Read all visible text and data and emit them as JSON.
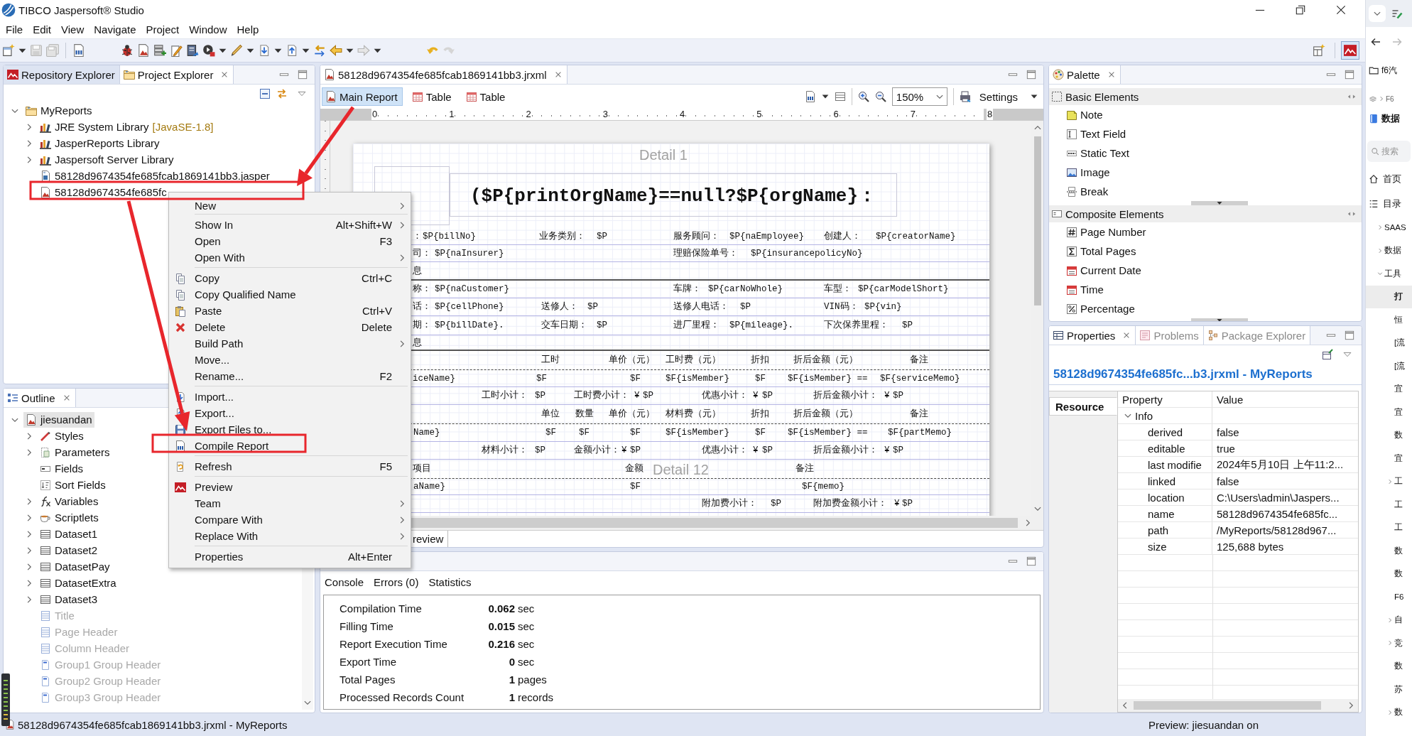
{
  "window": {
    "title": "TIBCO Jaspersoft® Studio"
  },
  "menu": [
    "File",
    "Edit",
    "View",
    "Navigate",
    "Project",
    "Window",
    "Help"
  ],
  "project_explorer": {
    "tabs": [
      {
        "label": "Repository Explorer",
        "selected": false
      },
      {
        "label": "Project Explorer",
        "selected": true
      }
    ],
    "tree": [
      {
        "label": "MyReports",
        "kind": "project",
        "expandable": true,
        "expanded": true,
        "children": [
          {
            "label": "JRE System Library",
            "decoration": "[JavaSE-1.8]",
            "kind": "library",
            "expandable": true,
            "expanded": false
          },
          {
            "label": "JasperReports Library",
            "kind": "library",
            "expandable": true,
            "expanded": false
          },
          {
            "label": "Jaspersoft Server Library",
            "kind": "library",
            "expandable": true,
            "expanded": false
          },
          {
            "label": "58128d9674354fe685fcab1869141bb3.jasper",
            "kind": "compiled",
            "expandable": false,
            "expanded": false
          },
          {
            "label": "58128d9674354fe685fc",
            "kind": "report",
            "expandable": false,
            "expanded": false
          }
        ]
      }
    ]
  },
  "outline": {
    "tab": "Outline",
    "tree": [
      {
        "label": "jiesuandan",
        "kind": "report",
        "expandable": true,
        "expanded": true,
        "selected": true,
        "disabled": false,
        "children": [
          {
            "label": "Styles",
            "kind": "styles",
            "expandable": true,
            "expanded": false,
            "selected": false,
            "disabled": false
          },
          {
            "label": "Parameters",
            "kind": "parameters",
            "expandable": true,
            "expanded": false,
            "selected": false,
            "disabled": false
          },
          {
            "label": "Fields",
            "kind": "fields",
            "expandable": false,
            "expanded": false,
            "selected": false,
            "disabled": false
          },
          {
            "label": "Sort Fields",
            "kind": "sort_fields",
            "expandable": false,
            "expanded": false,
            "selected": false,
            "disabled": false
          },
          {
            "label": "Variables",
            "kind": "variables",
            "expandable": true,
            "expanded": false,
            "selected": false,
            "disabled": false
          },
          {
            "label": "Scriptlets",
            "kind": "scriptlets",
            "expandable": true,
            "expanded": false,
            "selected": false,
            "disabled": false
          },
          {
            "label": "Dataset1",
            "kind": "dataset",
            "expandable": true,
            "expanded": false,
            "selected": false,
            "disabled": false
          },
          {
            "label": "Dataset2",
            "kind": "dataset",
            "expandable": true,
            "expanded": false,
            "selected": false,
            "disabled": false
          },
          {
            "label": "DatasetPay",
            "kind": "dataset",
            "expandable": true,
            "expanded": false,
            "selected": false,
            "disabled": false
          },
          {
            "label": "DatasetExtra",
            "kind": "dataset",
            "expandable": true,
            "expanded": false,
            "selected": false,
            "disabled": false
          },
          {
            "label": "Dataset3",
            "kind": "dataset",
            "expandable": true,
            "expanded": false,
            "selected": false,
            "disabled": false
          },
          {
            "label": "Title",
            "kind": "band",
            "expandable": false,
            "expanded": false,
            "selected": false,
            "disabled": true
          },
          {
            "label": "Page Header",
            "kind": "band",
            "expandable": false,
            "expanded": false,
            "selected": false,
            "disabled": true
          },
          {
            "label": "Column Header",
            "kind": "band",
            "expandable": false,
            "expanded": false,
            "selected": false,
            "disabled": true
          },
          {
            "label": "Group1 Group Header",
            "kind": "group_band",
            "expandable": false,
            "expanded": false,
            "selected": false,
            "disabled": true
          },
          {
            "label": "Group2 Group Header",
            "kind": "group_band",
            "expandable": false,
            "expanded": false,
            "selected": false,
            "disabled": true
          },
          {
            "label": "Group3 Group Header",
            "kind": "group_band",
            "expandable": false,
            "expanded": false,
            "selected": false,
            "disabled": true
          }
        ]
      }
    ]
  },
  "editor": {
    "tab": "58128d9674354fe685fcab1869141bb3.jrxml",
    "views": [
      {
        "label": "Main Report",
        "selected": true
      },
      {
        "label": "Table",
        "selected": false
      },
      {
        "label": "Table",
        "selected": false
      }
    ],
    "zoom": "150%",
    "settings": "Settings",
    "ruler": [
      "0",
      "1",
      "2",
      "3",
      "4",
      "5",
      "6",
      "7",
      "8"
    ],
    "band_labels": [
      "Detail 1",
      "Detail 12"
    ],
    "title": "($P{printOrgName}==null?$P{orgName}：",
    "canvas_lines": [
      {
        "kind": "fields",
        "texts": [
          "：",
          "$P{billNo}",
          "业务类别：",
          "$P",
          "服务顾问：",
          "$P{naEmployee}",
          "创建人：",
          "$P{creatorName}"
        ]
      },
      {
        "kind": "fields",
        "texts": [
          "司：",
          "$P{naInsurer}",
          "理赔保险单号：",
          "$P{insurancepolicyNo}"
        ]
      },
      {
        "kind": "section",
        "texts": [
          "息"
        ]
      },
      {
        "kind": "fields",
        "texts": [
          "称：",
          "$P{naCustomer}",
          "车牌：",
          "$P{carNoWhole}",
          "车型：",
          "$P{carModelShort}"
        ]
      },
      {
        "kind": "fields",
        "texts": [
          "话：",
          "$P{cellPhone}",
          "送修人：",
          "$P",
          "送修人电话：",
          "$P",
          "VIN码：",
          "$P{vin}"
        ]
      },
      {
        "kind": "fields",
        "texts": [
          "期：",
          "$P{billDate}.",
          "交车日期：",
          "$P",
          "进厂里程：",
          "$P{mileage}.",
          "下次保养里程：",
          "$P"
        ]
      },
      {
        "kind": "section",
        "texts": [
          "息"
        ]
      },
      {
        "kind": "header",
        "texts": [
          "工时",
          "单价（元）",
          "工时费（元）",
          "折扣",
          "折后金额（元）",
          "备注"
        ]
      },
      {
        "kind": "fields",
        "texts": [
          "iceName}",
          "$F",
          "$F",
          "$F{isMember}",
          "$F",
          "$F{isMember} ==",
          "$F{serviceMemo}"
        ]
      },
      {
        "kind": "fields",
        "texts": [
          "工时小计：",
          "$P",
          "工时费小计：",
          "¥",
          "$P",
          "优惠小计：",
          "¥",
          "$P",
          "折后金额小计：",
          "¥",
          "$P"
        ]
      },
      {
        "kind": "header",
        "texts": [
          "单位",
          "数量",
          "单价（元）",
          "材料费（元）",
          "折扣",
          "折后金额（元）",
          "备注"
        ]
      },
      {
        "kind": "fields",
        "texts": [
          "Name}",
          "$F",
          "$F",
          "$F",
          "$F{isMember}",
          "$F",
          "$F{isMember} ==",
          "$F{partMemo}"
        ]
      },
      {
        "kind": "fields",
        "texts": [
          "材料小计：",
          "$P",
          "金额小计：",
          "¥",
          "$P",
          "优惠小计：",
          "¥",
          "$P",
          "折后金额小计：",
          "¥",
          "$P"
        ]
      },
      {
        "kind": "header",
        "texts": [
          "项目",
          "金额",
          "备注"
        ]
      },
      {
        "kind": "fields",
        "texts": [
          "aName}",
          "$F",
          "$F{memo}"
        ]
      },
      {
        "kind": "fields",
        "texts": [
          "附加费小计：",
          "$P",
          "附加费金额小计：",
          "¥",
          "$P"
        ]
      }
    ],
    "bottom_tabs": [
      {
        "label": "review",
        "selected": false
      }
    ]
  },
  "context_menu": {
    "groups": [
      [
        {
          "label": "New",
          "submenu": true
        }
      ],
      [
        {
          "label": "Show In",
          "shortcut": "Alt+Shift+W",
          "submenu": true
        },
        {
          "label": "Open",
          "shortcut": "F3",
          "submenu": false
        },
        {
          "label": "Open With",
          "submenu": true
        }
      ],
      [
        {
          "label": "Copy",
          "shortcut": "Ctrl+C",
          "submenu": false
        },
        {
          "label": "Copy Qualified Name",
          "submenu": false
        },
        {
          "label": "Paste",
          "shortcut": "Ctrl+V",
          "submenu": false
        },
        {
          "label": "Delete",
          "shortcut": "Delete",
          "submenu": false
        },
        {
          "label": "Build Path",
          "submenu": true
        },
        {
          "label": "Move...",
          "submenu": false
        },
        {
          "label": "Rename...",
          "shortcut": "F2",
          "submenu": false
        }
      ],
      [
        {
          "label": "Import...",
          "submenu": false
        },
        {
          "label": "Export...",
          "submenu": false
        },
        {
          "label": "Export Files to...",
          "submenu": false
        },
        {
          "label": "Compile Report",
          "submenu": false
        }
      ],
      [
        {
          "label": "Refresh",
          "shortcut": "F5",
          "submenu": false
        }
      ],
      [
        {
          "label": "Preview",
          "submenu": false
        },
        {
          "label": "Team",
          "submenu": true
        },
        {
          "label": "Compare With",
          "submenu": true
        },
        {
          "label": "Replace With",
          "submenu": true
        }
      ],
      [
        {
          "label": "Properties",
          "shortcut": "Alt+Enter",
          "submenu": false
        }
      ]
    ]
  },
  "console": {
    "tabs": [
      "Console",
      "Errors (0)",
      "Statistics"
    ],
    "stats": [
      {
        "label": "Compilation Time",
        "value": "0.062",
        "unit": "sec"
      },
      {
        "label": "Filling Time",
        "value": "0.015",
        "unit": "sec"
      },
      {
        "label": "Report Execution Time",
        "value": "0.216",
        "unit": "sec"
      },
      {
        "label": "Export Time",
        "value": "0",
        "unit": "sec"
      },
      {
        "label": "Total Pages",
        "value": "1",
        "unit": "pages"
      },
      {
        "label": "Processed Records Count",
        "value": "1",
        "unit": "records"
      }
    ]
  },
  "palette": {
    "tab": "Palette",
    "sections": [
      {
        "title": "Basic Elements",
        "items": [
          {
            "label": "Note",
            "kind": "note"
          },
          {
            "label": "Text Field",
            "kind": "text_field"
          },
          {
            "label": "Static Text",
            "kind": "static_text"
          },
          {
            "label": "Image",
            "kind": "image"
          },
          {
            "label": "Break",
            "kind": "break"
          }
        ]
      },
      {
        "title": "Composite Elements",
        "items": [
          {
            "label": "Page Number",
            "kind": "page_number"
          },
          {
            "label": "Total Pages",
            "kind": "total_pages"
          },
          {
            "label": "Current Date",
            "kind": "current_date"
          },
          {
            "label": "Time",
            "kind": "time"
          },
          {
            "label": "Percentage",
            "kind": "percentage"
          }
        ]
      }
    ]
  },
  "properties": {
    "tabs": [
      {
        "label": "Properties",
        "selected": true
      },
      {
        "label": "Problems",
        "selected": false
      },
      {
        "label": "Package Explorer",
        "selected": false
      }
    ],
    "heading": "58128d9674354fe685fc...b3.jrxml - MyReports",
    "side_tabs": [
      {
        "label": "Resource",
        "selected": true
      }
    ],
    "columns": [
      "Property",
      "Value"
    ],
    "groups": [
      {
        "label": "Info",
        "expanded": true,
        "rows": [
          {
            "property": "derived",
            "value": "false"
          },
          {
            "property": "editable",
            "value": "true"
          },
          {
            "property": "last modifie",
            "value": "2024年5月10日 上午11:2..."
          },
          {
            "property": "linked",
            "value": "false"
          },
          {
            "property": "location",
            "value": "C:\\Users\\admin\\Jaspers..."
          },
          {
            "property": "name",
            "value": "58128d9674354fe685fc..."
          },
          {
            "property": "path",
            "value": "/MyReports/58128d967..."
          },
          {
            "property": "size",
            "value": "125,688 bytes"
          }
        ]
      }
    ]
  },
  "status_bar": {
    "left": "58128d9674354fe685fcab1869141bb3.jrxml - MyReports",
    "right": "Preview: jiesuandan on"
  },
  "browser_sidebar": {
    "folder": "f6汽",
    "breadcrumb": "F6",
    "doc_title": "数据",
    "search": {
      "placeholder": "搜索"
    },
    "nav": [
      "首页",
      "目录"
    ],
    "tree": [
      {
        "label": "SAAS",
        "expandable": true,
        "expanded": false,
        "selected": false
      },
      {
        "label": "数据",
        "expandable": true,
        "expanded": false,
        "selected": false
      },
      {
        "label": "工具",
        "expandable": true,
        "expanded": true,
        "selected": false,
        "children": [
          {
            "label": "打",
            "expandable": false,
            "expanded": false,
            "selected": true
          },
          {
            "label": "恒",
            "expandable": false,
            "expanded": false,
            "selected": false
          },
          {
            "label": "[流",
            "expandable": false,
            "expanded": false,
            "selected": false
          },
          {
            "label": "[流",
            "expandable": false,
            "expanded": false,
            "selected": false
          },
          {
            "label": "宜",
            "expandable": false,
            "expanded": false,
            "selected": false
          },
          {
            "label": "宜",
            "expandable": false,
            "expanded": false,
            "selected": false
          },
          {
            "label": "数",
            "expandable": false,
            "expanded": false,
            "selected": false
          },
          {
            "label": "宜",
            "expandable": false,
            "expanded": false,
            "selected": false
          },
          {
            "label": "工",
            "expandable": true,
            "expanded": false,
            "selected": false
          },
          {
            "label": "工",
            "expandable": false,
            "expanded": false,
            "selected": false
          },
          {
            "label": "工",
            "expandable": false,
            "expanded": false,
            "selected": false
          },
          {
            "label": "数",
            "expandable": false,
            "expanded": false,
            "selected": false
          },
          {
            "label": "数",
            "expandable": false,
            "expanded": false,
            "selected": false
          },
          {
            "label": "F6",
            "expandable": false,
            "expanded": false,
            "selected": false
          },
          {
            "label": "自",
            "expandable": true,
            "expanded": false,
            "selected": false
          },
          {
            "label": "竞",
            "expandable": true,
            "expanded": false,
            "selected": false
          },
          {
            "label": "数",
            "expandable": false,
            "expanded": false,
            "selected": false
          },
          {
            "label": "苏",
            "expandable": false,
            "expanded": false,
            "selected": false
          },
          {
            "label": "数",
            "expandable": true,
            "expanded": false,
            "selected": false
          }
        ]
      }
    ]
  }
}
